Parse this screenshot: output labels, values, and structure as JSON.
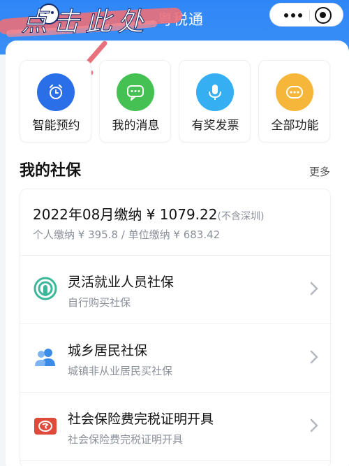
{
  "header": {
    "title": "粤税通",
    "overlay_text": "点击此处",
    "capsule": {
      "more_icon": "more-dots-icon",
      "close_icon": "target-circle-icon"
    }
  },
  "quick_actions": [
    {
      "label": "智能预约",
      "icon": "alarm-clock-icon",
      "color": "#2b6fe8"
    },
    {
      "label": "我的消息",
      "icon": "chat-bubble-icon",
      "color": "#45c153"
    },
    {
      "label": "有奖发票",
      "icon": "microphone-icon",
      "color": "#36aef2"
    },
    {
      "label": "全部功能",
      "icon": "more-dots-icon",
      "color": "#f5b63a"
    }
  ],
  "social_security": {
    "section_title": "我的社保",
    "more_label": "更多",
    "payment": {
      "main": "2022年08月缴纳 ¥ 1079.22",
      "note": "(不含深圳)",
      "sub": "个人缴纳 ¥ 395.8 / 单位缴纳 ¥ 683.42"
    },
    "items": [
      {
        "title": "灵活就业人员社保",
        "subtitle": "自行购买社保",
        "icon": "podcast-icon",
        "color": "#3bb89a"
      },
      {
        "title": "城乡居民社保",
        "subtitle": "城镇非从业居民买社保",
        "icon": "people-icon",
        "color": "#3d8be8"
      },
      {
        "title": "社会保险费完税证明开具",
        "subtitle": "社会保险费完税证明开具",
        "icon": "social-insurance-icon",
        "color": "#e04a3b"
      }
    ]
  }
}
